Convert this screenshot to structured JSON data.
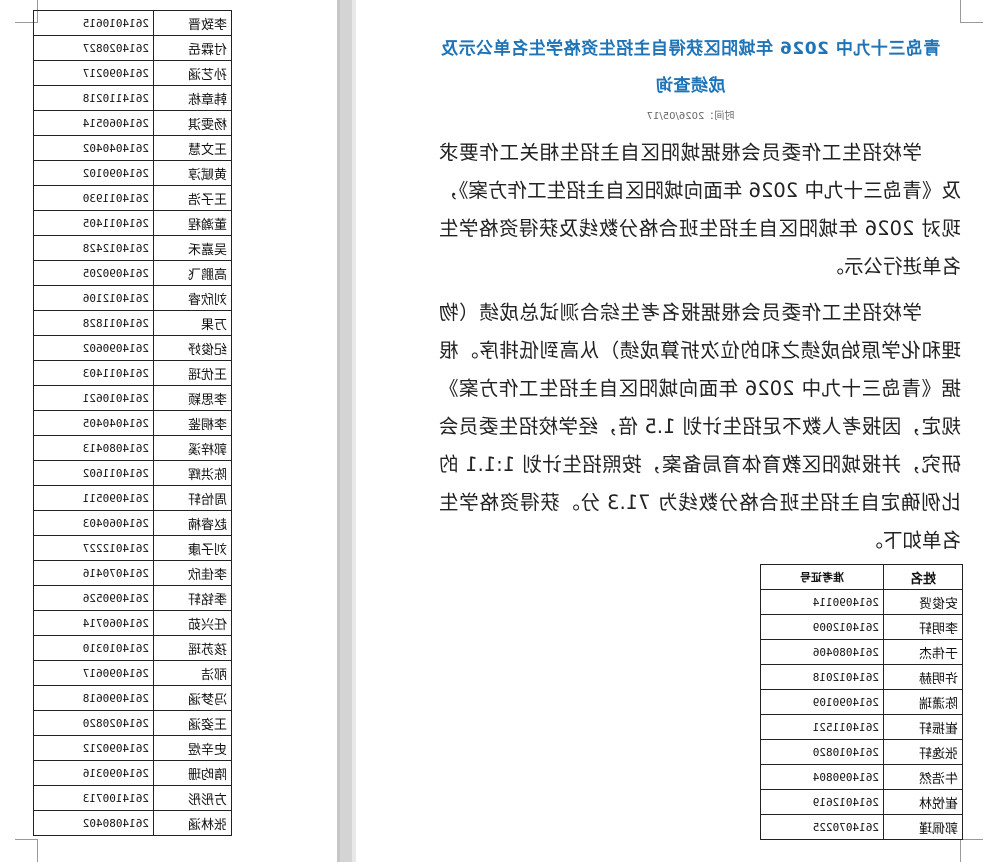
{
  "document": {
    "title": "青岛三十九中 2026 年城阳区获得自主招生资格学生名单公示及成绩查询",
    "publish_time": "时间：2026/05/17",
    "paragraphs": [
      "学校招生工作委员会根据城阳区自主招生相关工作要求及《青岛三十九中 2026 年面向城阳区自主招生工作方案》，现对 2026 年城阳区自主招生班合格分数线及获得资格学生名单进行公示。",
      "学校招生工作委员会根据报名考生综合测试总成绩（物理和化学原始成绩之和的位次折算成绩）从高到低排序。根据《青岛三十九中 2026 年面向城阳区自主招生工作方案》规定，因报考人数不足招生计划 1.5 倍，经学校招生委员会研究，并报城阳区教育体育局备案，按照招生计划 1:1.1 的比例确定自主招生班合格分数线为 71.3 分。获得资格学生名单如下。"
    ],
    "table_headers": {
      "name": "姓名",
      "id": "准考证号"
    },
    "table_page1": [
      {
        "name": "安俊贤",
        "id": "2614090114"
      },
      {
        "name": "李明轩",
        "id": "2614012009"
      },
      {
        "name": "于伟杰",
        "id": "2614080406"
      },
      {
        "name": "许明赫",
        "id": "2614012018"
      },
      {
        "name": "陈潇瑞",
        "id": "2614090109"
      },
      {
        "name": "崔振轩",
        "id": "2614011521"
      },
      {
        "name": "张逸轩",
        "id": "2614010820"
      },
      {
        "name": "牛浩然",
        "id": "2614090804"
      },
      {
        "name": "崔悦林",
        "id": "2614012619"
      },
      {
        "name": "郭佩瑾",
        "id": "2614070225"
      }
    ],
    "table_page2": [
      {
        "name": "李致晋",
        "id": "2614010615"
      },
      {
        "name": "付霖岳",
        "id": "2614020827"
      },
      {
        "name": "孙艺涵",
        "id": "2614090217"
      },
      {
        "name": "韩章栋",
        "id": "2614110218"
      },
      {
        "name": "杨雯淇",
        "id": "2614060514"
      },
      {
        "name": "王文慧",
        "id": "2614040402"
      },
      {
        "name": "黄赋淳",
        "id": "2614090102"
      },
      {
        "name": "王子浩",
        "id": "2614011930"
      },
      {
        "name": "董瀚程",
        "id": "2614011405"
      },
      {
        "name": "吴嘉禾",
        "id": "2614012428"
      },
      {
        "name": "高鹏飞",
        "id": "2614090205"
      },
      {
        "name": "刘欣睿",
        "id": "2614012106"
      },
      {
        "name": "万果",
        "id": "2614011828"
      },
      {
        "name": "纪俊妤",
        "id": "2614090602"
      },
      {
        "name": "王优瑶",
        "id": "2614011403"
      },
      {
        "name": "李思颖",
        "id": "2614010621"
      },
      {
        "name": "李桐鉴",
        "id": "2614040405"
      },
      {
        "name": "郭梓溪",
        "id": "2614080413"
      },
      {
        "name": "陈洪辉",
        "id": "2614011602"
      },
      {
        "name": "周怡轩",
        "id": "2614090511"
      },
      {
        "name": "赵睿楠",
        "id": "2614060403"
      },
      {
        "name": "刘子康",
        "id": "2614012227"
      },
      {
        "name": "李佳欣",
        "id": "2614070416"
      },
      {
        "name": "季铭轩",
        "id": "2614090526"
      },
      {
        "name": "任兴茹",
        "id": "2614060714"
      },
      {
        "name": "孩苏瑶",
        "id": "2614010310"
      },
      {
        "name": "邴洁",
        "id": "2614090617"
      },
      {
        "name": "冯梦涵",
        "id": "2614090618"
      },
      {
        "name": "王姿涵",
        "id": "2614020820"
      },
      {
        "name": "史辛煜",
        "id": "2614090212"
      },
      {
        "name": "隋昀珊",
        "id": "2614090316"
      },
      {
        "name": "方彤彤",
        "id": "2614100713"
      },
      {
        "name": "张林涵",
        "id": "2614080402"
      }
    ]
  },
  "colors": {
    "title": "#1f74b8",
    "gutter": "#d4d4d4"
  }
}
